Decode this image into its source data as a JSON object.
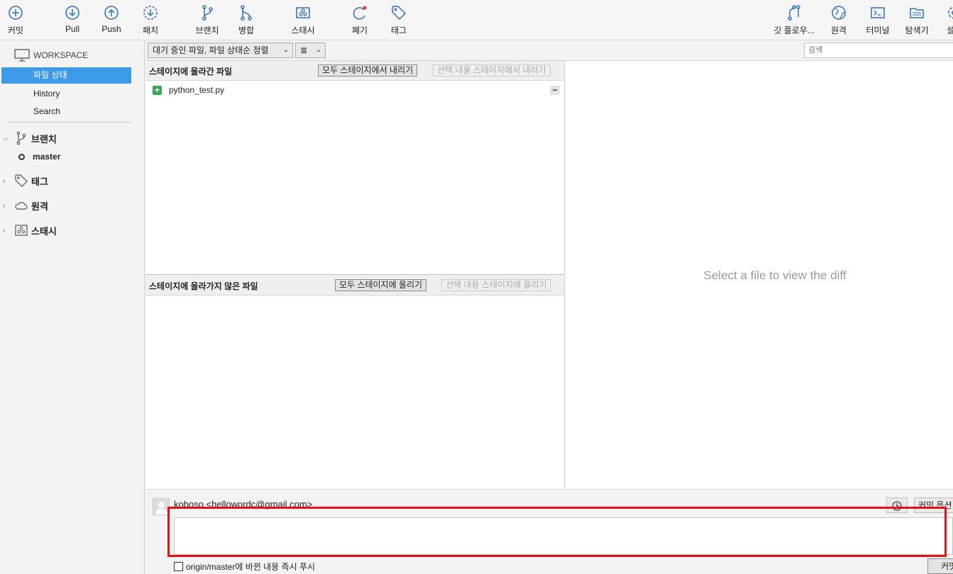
{
  "toolbar": {
    "commit": "커밋",
    "pull": "Pull",
    "push": "Push",
    "patch": "패치",
    "branch": "브랜치",
    "merge": "병합",
    "stash": "스태시",
    "discard": "폐기",
    "tag": "태그",
    "gitflow": "깃 플로우...",
    "remote": "원격",
    "terminal": "터미널",
    "explorer": "탐색기",
    "settings": "설정"
  },
  "sidebar": {
    "workspace": "WORKSPACE",
    "items": [
      "파일 상태",
      "History",
      "Search"
    ],
    "branches": "브랜치",
    "current_branch": "master",
    "tags": "태그",
    "remotes": "원격",
    "stashes": "스태시"
  },
  "filterbar": {
    "filter_dropdown": "대기 중인 파일, 파일 상태순 정렬",
    "view_dropdown": "≣",
    "search_placeholder": "검색"
  },
  "staged": {
    "title": "스테이지에 올라간 파일",
    "unstage_all": "모두 스테이지에서 내리기",
    "unstage_selected": "선택 내용 스테이지에서 내리기",
    "files": [
      "python_test.py"
    ]
  },
  "unstaged": {
    "title": "스테이지에 올라가지 않은 파일",
    "stage_all": "모두 스테이지에 올리기",
    "stage_selected": "선택 내용 스테이지에 올리기"
  },
  "diff": {
    "empty_message": "Select a file to view the diff"
  },
  "commit": {
    "author": "koboso <hellowordc@gmail.com>",
    "options_label": "커밋 옵션",
    "message": "",
    "push_label": "origin/master에 바뀐 내용 즉시 푸시",
    "push_checked": false,
    "commit_button": "커밋"
  },
  "colors": {
    "accent": "#3d9ae8",
    "highlight": "#e0141b",
    "icon": "#2f6fb5",
    "added": "#35a853"
  }
}
